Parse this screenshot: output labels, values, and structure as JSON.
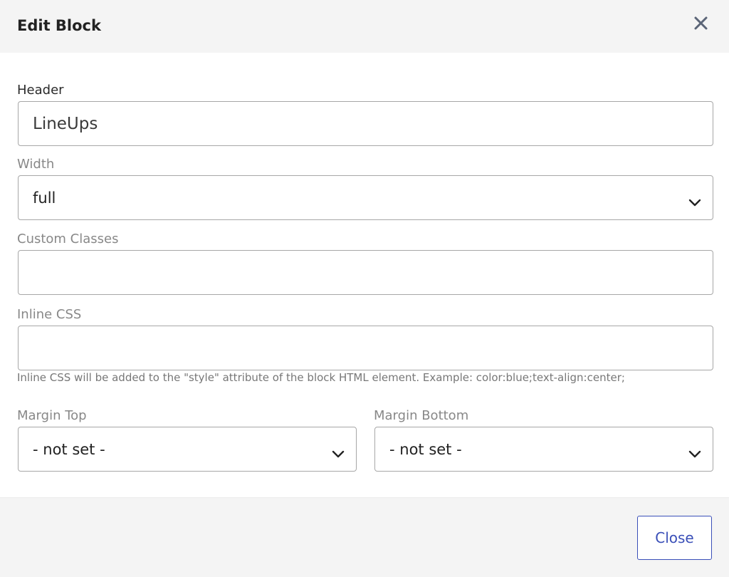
{
  "modal": {
    "title": "Edit Block",
    "close_icon": "close-icon"
  },
  "form": {
    "header": {
      "label": "Header",
      "value": "LineUps"
    },
    "width": {
      "label": "Width",
      "selected": "full",
      "icon": "chevron-down-icon"
    },
    "custom_classes": {
      "label": "Custom Classes",
      "value": ""
    },
    "inline_css": {
      "label": "Inline CSS",
      "value": "",
      "help": "Inline CSS will be added to the \"style\" attribute of the block HTML element. Example: color:blue;text-align:center;"
    },
    "margin_top": {
      "label": "Margin Top",
      "selected": "- not set -",
      "icon": "chevron-down-icon"
    },
    "margin_bottom": {
      "label": "Margin Bottom",
      "selected": "- not set -",
      "icon": "chevron-down-icon"
    }
  },
  "footer": {
    "close_label": "Close"
  },
  "colors": {
    "accent": "#3a4fb8",
    "header_bg": "#f4f4f4",
    "border": "#a7a7a7"
  }
}
